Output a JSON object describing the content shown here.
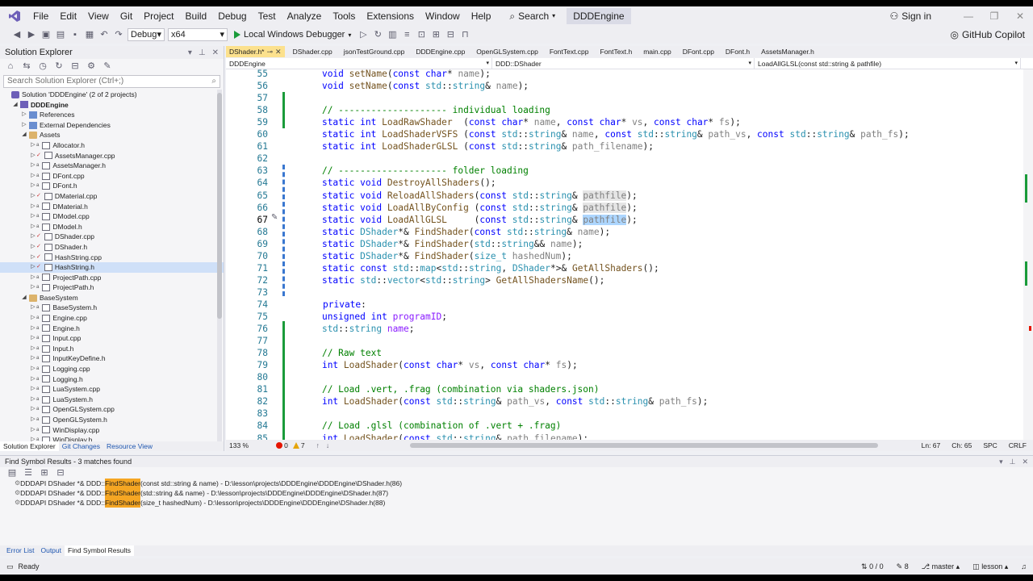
{
  "menu": {
    "items": [
      "File",
      "Edit",
      "View",
      "Git",
      "Project",
      "Build",
      "Debug",
      "Test",
      "Analyze",
      "Tools",
      "Extensions",
      "Window",
      "Help"
    ],
    "search_label": "Search",
    "solution_name": "DDDEngine",
    "sign_in": "Sign in"
  },
  "toolbar": {
    "config": "Debug",
    "platform": "x64",
    "run_label": "Local Windows Debugger",
    "copilot": "GitHub Copilot"
  },
  "solution_explorer": {
    "title": "Solution Explorer",
    "search_placeholder": "Search Solution Explorer (Ctrl+;)",
    "items": [
      {
        "label": "Solution 'DDDEngine' (2 of 2 projects)",
        "indent": 0,
        "kind": "sol",
        "tri": ""
      },
      {
        "label": "DDDEngine",
        "indent": 1,
        "kind": "proj",
        "tri": "◢",
        "bold": true
      },
      {
        "label": "References",
        "indent": 2,
        "kind": "ref",
        "tri": "▷"
      },
      {
        "label": "External Dependencies",
        "indent": 2,
        "kind": "ref",
        "tri": "▷"
      },
      {
        "label": "Assets",
        "indent": 2,
        "kind": "folder",
        "tri": "◢"
      },
      {
        "label": "Allocator.h",
        "indent": 3,
        "kind": "h",
        "tri": "▷",
        "lock": true
      },
      {
        "label": "AssetsManager.cpp",
        "indent": 3,
        "kind": "cpp",
        "tri": "▷",
        "check": true
      },
      {
        "label": "AssetsManager.h",
        "indent": 3,
        "kind": "h",
        "tri": "▷",
        "lock": true
      },
      {
        "label": "DFont.cpp",
        "indent": 3,
        "kind": "cpp",
        "tri": "▷",
        "lock": true
      },
      {
        "label": "DFont.h",
        "indent": 3,
        "kind": "h",
        "tri": "▷",
        "lock": true
      },
      {
        "label": "DMaterial.cpp",
        "indent": 3,
        "kind": "cpp",
        "tri": "▷",
        "check": true
      },
      {
        "label": "DMaterial.h",
        "indent": 3,
        "kind": "h",
        "tri": "▷",
        "lock": true
      },
      {
        "label": "DModel.cpp",
        "indent": 3,
        "kind": "cpp",
        "tri": "▷",
        "lock": true
      },
      {
        "label": "DModel.h",
        "indent": 3,
        "kind": "h",
        "tri": "▷",
        "lock": true
      },
      {
        "label": "DShader.cpp",
        "indent": 3,
        "kind": "cpp",
        "tri": "▷",
        "check": true
      },
      {
        "label": "DShader.h",
        "indent": 3,
        "kind": "h",
        "tri": "▷",
        "check": true
      },
      {
        "label": "HashString.cpp",
        "indent": 3,
        "kind": "cpp",
        "tri": "▷",
        "check": true
      },
      {
        "label": "HashString.h",
        "indent": 3,
        "kind": "h",
        "tri": "▷",
        "check": true,
        "selected": true
      },
      {
        "label": "ProjectPath.cpp",
        "indent": 3,
        "kind": "cpp",
        "tri": "▷",
        "lock": true
      },
      {
        "label": "ProjectPath.h",
        "indent": 3,
        "kind": "h",
        "tri": "▷",
        "lock": true
      },
      {
        "label": "BaseSystem",
        "indent": 2,
        "kind": "folder",
        "tri": "◢"
      },
      {
        "label": "BaseSystem.h",
        "indent": 3,
        "kind": "h",
        "tri": "▷",
        "lock": true
      },
      {
        "label": "Engine.cpp",
        "indent": 3,
        "kind": "cpp",
        "tri": "▷",
        "lock": true
      },
      {
        "label": "Engine.h",
        "indent": 3,
        "kind": "h",
        "tri": "▷",
        "lock": true
      },
      {
        "label": "Input.cpp",
        "indent": 3,
        "kind": "cpp",
        "tri": "▷",
        "lock": true
      },
      {
        "label": "Input.h",
        "indent": 3,
        "kind": "h",
        "tri": "▷",
        "lock": true
      },
      {
        "label": "InputKeyDefine.h",
        "indent": 3,
        "kind": "h",
        "tri": "▷",
        "lock": true
      },
      {
        "label": "Logging.cpp",
        "indent": 3,
        "kind": "cpp",
        "tri": "▷",
        "lock": true
      },
      {
        "label": "Logging.h",
        "indent": 3,
        "kind": "h",
        "tri": "▷",
        "lock": true
      },
      {
        "label": "LuaSystem.cpp",
        "indent": 3,
        "kind": "cpp",
        "tri": "▷",
        "lock": true
      },
      {
        "label": "LuaSystem.h",
        "indent": 3,
        "kind": "h",
        "tri": "▷",
        "lock": true
      },
      {
        "label": "OpenGLSystem.cpp",
        "indent": 3,
        "kind": "cpp",
        "tri": "▷",
        "lock": true
      },
      {
        "label": "OpenGLSystem.h",
        "indent": 3,
        "kind": "h",
        "tri": "▷",
        "lock": true
      },
      {
        "label": "WinDisplay.cpp",
        "indent": 3,
        "kind": "cpp",
        "tri": "▷",
        "lock": true
      },
      {
        "label": "WinDisplay.h",
        "indent": 3,
        "kind": "h",
        "tri": "▷",
        "lock": true
      }
    ],
    "tabs": [
      "Solution Explorer",
      "Git Changes",
      "Resource View"
    ]
  },
  "editor": {
    "tabs": [
      "DShader.h*",
      "DShader.cpp",
      "jsonTestGround.cpp",
      "DDDEngine.cpp",
      "OpenGLSystem.cpp",
      "FontText.cpp",
      "FontText.h",
      "main.cpp",
      "DFont.cpp",
      "DFont.h",
      "AssetsManager.h"
    ],
    "nav": [
      "DDDEngine",
      "DDD::DShader",
      "LoadAllGLSL(const std::string & pathfile)"
    ],
    "zoom": "133 %",
    "errors": "0",
    "warnings": "7",
    "ln": "Ln: 67",
    "ch": "Ch: 65",
    "spc": "SPC",
    "crlf": "CRLF"
  },
  "find_results": {
    "title": "Find Symbol Results - 3 matches found",
    "rows": [
      {
        "pre": "DDDAPI DShader *& DDD::",
        "match": "FindShader",
        "post": "(const std::string & name) - D:\\lesson\\projects\\DDDEngine\\DDDEngine\\DShader.h(86)"
      },
      {
        "pre": "DDDAPI DShader *& DDD::",
        "match": "FindShader",
        "post": "(std::string && name) - D:\\lesson\\projects\\DDDEngine\\DDDEngine\\DShader.h(87)"
      },
      {
        "pre": "DDDAPI DShader *& DDD::",
        "match": "FindShader",
        "post": "(size_t hashedNum) - D:\\lesson\\projects\\DDDEngine\\DDDEngine\\DShader.h(88)"
      }
    ]
  },
  "bottom_tabs": [
    "Error List",
    "Output",
    "Find Symbol Results"
  ],
  "status": {
    "ready": "Ready",
    "arrows": "0 / 0",
    "pencil": "8",
    "branch": "master",
    "repo": "lesson"
  },
  "colors": {
    "accent": "#6d5fb8",
    "tab_active": "#fce18d",
    "keyword": "#0000ff",
    "type": "#2b91af",
    "comment": "#008000"
  }
}
